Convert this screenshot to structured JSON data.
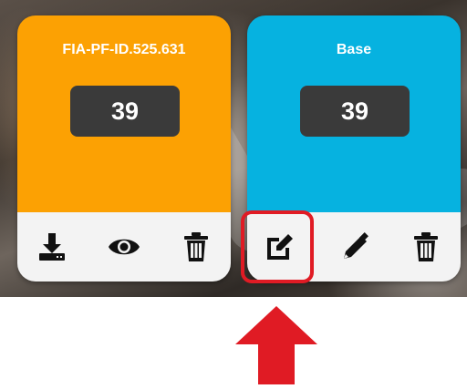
{
  "cards": [
    {
      "title": "FIA-PF-ID.525.631",
      "count": "39",
      "color": "#fca103",
      "actions": [
        "download-icon",
        "eye-icon",
        "trash-icon"
      ]
    },
    {
      "title": "Base",
      "count": "39",
      "color": "#06b2e0",
      "actions": [
        "edit-square-icon",
        "pencil-icon",
        "trash-icon"
      ]
    }
  ],
  "annotation": {
    "highlight_color": "#e01b24",
    "arrow_color": "#e01b24",
    "target": "edit-square-icon"
  }
}
